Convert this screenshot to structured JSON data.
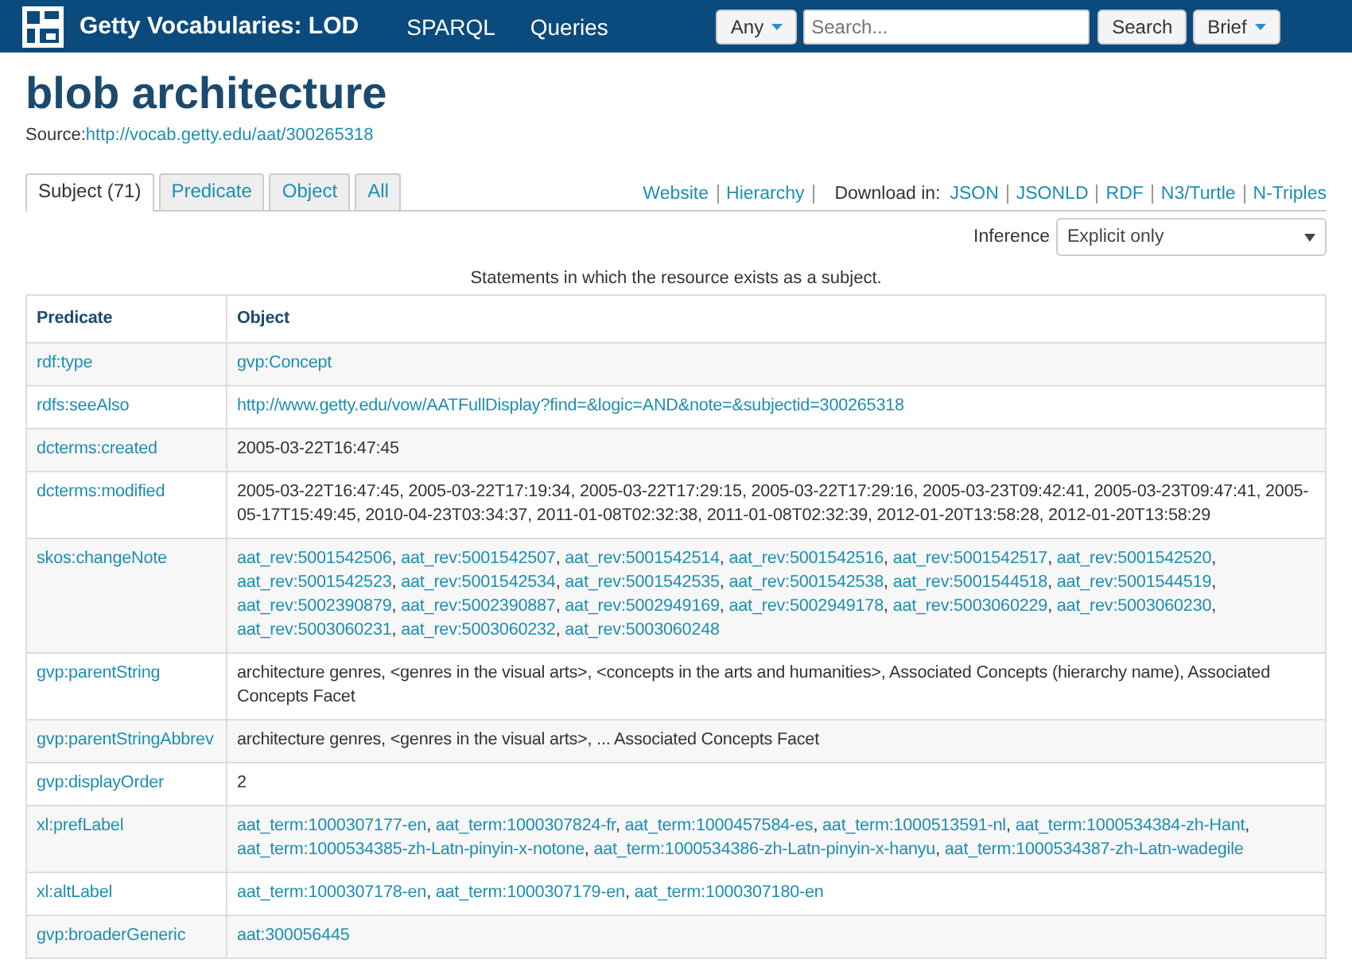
{
  "navbar": {
    "brand": "Getty Vocabularies: LOD",
    "links": [
      "SPARQL",
      "Queries"
    ],
    "scope": "Any",
    "search": {
      "placeholder": "Search..."
    },
    "search_button": "Search",
    "view": "Brief"
  },
  "title": "blob architecture",
  "source": {
    "label": "Source:",
    "url": "http://vocab.getty.edu/aat/300265318"
  },
  "tabs": [
    {
      "label": "Subject (71)",
      "selected": true
    },
    {
      "label": "Predicate",
      "selected": false
    },
    {
      "label": "Object",
      "selected": false
    },
    {
      "label": "All",
      "selected": false
    }
  ],
  "links": [
    "Website",
    "Hierarchy"
  ],
  "download": {
    "label": "Download in:",
    "formats": [
      "JSON",
      "JSONLD",
      "RDF",
      "N3/Turtle",
      "N-Triples"
    ]
  },
  "inference": {
    "label": "Inference",
    "value": "Explicit only"
  },
  "caption": "Statements in which the resource exists as a subject.",
  "table": {
    "columns": [
      "Predicate",
      "Object"
    ],
    "separator": ", ",
    "rows": [
      {
        "predicate": "rdf:type",
        "object": {
          "kind": "links",
          "items": [
            "gvp:Concept"
          ]
        }
      },
      {
        "predicate": "rdfs:seeAlso",
        "object": {
          "kind": "links",
          "items": [
            "http://www.getty.edu/vow/AATFullDisplay?find=&logic=AND&note=&subjectid=300265318"
          ]
        }
      },
      {
        "predicate": "dcterms:created",
        "object": {
          "kind": "text",
          "text": "2005-03-22T16:47:45"
        }
      },
      {
        "predicate": "dcterms:modified",
        "object": {
          "kind": "text",
          "text": "2005-03-22T16:47:45, 2005-03-22T17:19:34, 2005-03-22T17:29:15, 2005-03-22T17:29:16, 2005-03-23T09:42:41, 2005-03-23T09:47:41, 2005-05-17T15:49:45, 2010-04-23T03:34:37, 2011-01-08T02:32:38, 2011-01-08T02:32:39, 2012-01-20T13:58:28, 2012-01-20T13:58:29"
        }
      },
      {
        "predicate": "skos:changeNote",
        "object": {
          "kind": "links",
          "items": [
            "aat_rev:5001542506",
            "aat_rev:5001542507",
            "aat_rev:5001542514",
            "aat_rev:5001542516",
            "aat_rev:5001542517",
            "aat_rev:5001542520",
            "aat_rev:5001542523",
            "aat_rev:5001542534",
            "aat_rev:5001542535",
            "aat_rev:5001542538",
            "aat_rev:5001544518",
            "aat_rev:5001544519",
            "aat_rev:5002390879",
            "aat_rev:5002390887",
            "aat_rev:5002949169",
            "aat_rev:5002949178",
            "aat_rev:5003060229",
            "aat_rev:5003060230",
            "aat_rev:5003060231",
            "aat_rev:5003060232",
            "aat_rev:5003060248"
          ]
        }
      },
      {
        "predicate": "gvp:parentString",
        "object": {
          "kind": "text",
          "text": "architecture genres, <genres in the visual arts>, <concepts in the arts and humanities>, Associated Concepts (hierarchy name), Associated Concepts Facet"
        }
      },
      {
        "predicate": "gvp:parentStringAbbrev",
        "object": {
          "kind": "text",
          "text": "architecture genres, <genres in the visual arts>, ... Associated Concepts Facet"
        }
      },
      {
        "predicate": "gvp:displayOrder",
        "object": {
          "kind": "text",
          "text": "2"
        }
      },
      {
        "predicate": "xl:prefLabel",
        "object": {
          "kind": "links",
          "items": [
            "aat_term:1000307177-en",
            "aat_term:1000307824-fr",
            "aat_term:1000457584-es",
            "aat_term:1000513591-nl",
            "aat_term:1000534384-zh-Hant",
            "aat_term:1000534385-zh-Latn-pinyin-x-notone",
            "aat_term:1000534386-zh-Latn-pinyin-x-hanyu",
            "aat_term:1000534387-zh-Latn-wadegile"
          ]
        }
      },
      {
        "predicate": "xl:altLabel",
        "object": {
          "kind": "links",
          "items": [
            "aat_term:1000307178-en",
            "aat_term:1000307179-en",
            "aat_term:1000307180-en"
          ]
        }
      },
      {
        "predicate": "gvp:broaderGeneric",
        "object": {
          "kind": "links",
          "items": [
            "aat:300056445"
          ]
        }
      }
    ]
  }
}
